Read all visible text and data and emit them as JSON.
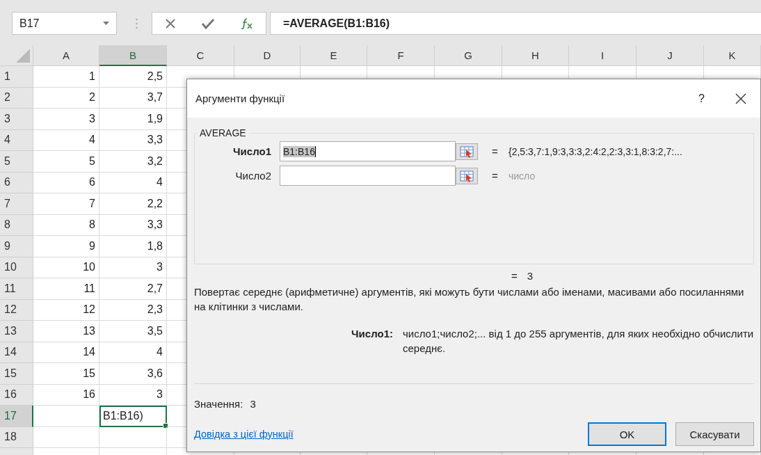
{
  "formula_bar": {
    "name_box": "B17",
    "formula": "=AVERAGE(B1:B16)"
  },
  "sheet": {
    "columns": [
      {
        "label": "A",
        "selected": false
      },
      {
        "label": "B",
        "selected": true
      },
      {
        "label": "C",
        "selected": false
      },
      {
        "label": "D",
        "selected": false
      },
      {
        "label": "E",
        "selected": false
      },
      {
        "label": "F",
        "selected": false
      },
      {
        "label": "G",
        "selected": false
      },
      {
        "label": "H",
        "selected": false
      },
      {
        "label": "I",
        "selected": false
      },
      {
        "label": "J",
        "selected": false
      },
      {
        "label": "K",
        "selected": false
      }
    ],
    "rows": [
      {
        "header": "1",
        "a": "1",
        "b": "2,5",
        "selected": false
      },
      {
        "header": "2",
        "a": "2",
        "b": "3,7",
        "selected": false
      },
      {
        "header": "3",
        "a": "3",
        "b": "1,9",
        "selected": false
      },
      {
        "header": "4",
        "a": "4",
        "b": "3,3",
        "selected": false
      },
      {
        "header": "5",
        "a": "5",
        "b": "3,2",
        "selected": false
      },
      {
        "header": "6",
        "a": "6",
        "b": "4",
        "selected": false
      },
      {
        "header": "7",
        "a": "7",
        "b": "2,2",
        "selected": false
      },
      {
        "header": "8",
        "a": "8",
        "b": "3,3",
        "selected": false
      },
      {
        "header": "9",
        "a": "9",
        "b": "1,8",
        "selected": false
      },
      {
        "header": "10",
        "a": "10",
        "b": "3",
        "selected": false
      },
      {
        "header": "11",
        "a": "11",
        "b": "2,7",
        "selected": false
      },
      {
        "header": "12",
        "a": "12",
        "b": "2,3",
        "selected": false
      },
      {
        "header": "13",
        "a": "13",
        "b": "3,5",
        "selected": false
      },
      {
        "header": "14",
        "a": "14",
        "b": "4",
        "selected": false
      },
      {
        "header": "15",
        "a": "15",
        "b": "3,6",
        "selected": false
      },
      {
        "header": "16",
        "a": "16",
        "b": "3",
        "selected": false
      },
      {
        "header": "17",
        "b": "B1:B16)",
        "selected": true
      },
      {
        "header": "18",
        "selected": false
      }
    ]
  },
  "dialog": {
    "title": "Аргументи функції",
    "help": "?",
    "function_name": "AVERAGE",
    "arguments": [
      {
        "label": "Число1",
        "value": "B1:B16",
        "active": true,
        "equals": "=",
        "result": "{2,5:3,7:1,9:3,3:3,2:4:2,2:3,3:1,8:3:2,7:...",
        "muted": false
      },
      {
        "label": "Число2",
        "active": false,
        "equals": "=",
        "result": "число",
        "muted": true
      }
    ],
    "formula_result": {
      "equals": "=",
      "value": "3"
    },
    "description": "Повертає середнє (арифметичне) аргументів, які можуть бути числами або іменами, масивами або посиланнями на клітинки з числами.",
    "argument_help": {
      "label": "Число1:",
      "text": "число1;число2;... від 1 до 255 аргументів, для яких необхідно обчислити середнє."
    },
    "value": {
      "label": "Значення:",
      "value": "3"
    },
    "help_link": "Довідка з цієї функції",
    "buttons": [
      {
        "label": "OK",
        "default": true
      },
      {
        "label": "Скасувати",
        "default": false
      }
    ]
  }
}
